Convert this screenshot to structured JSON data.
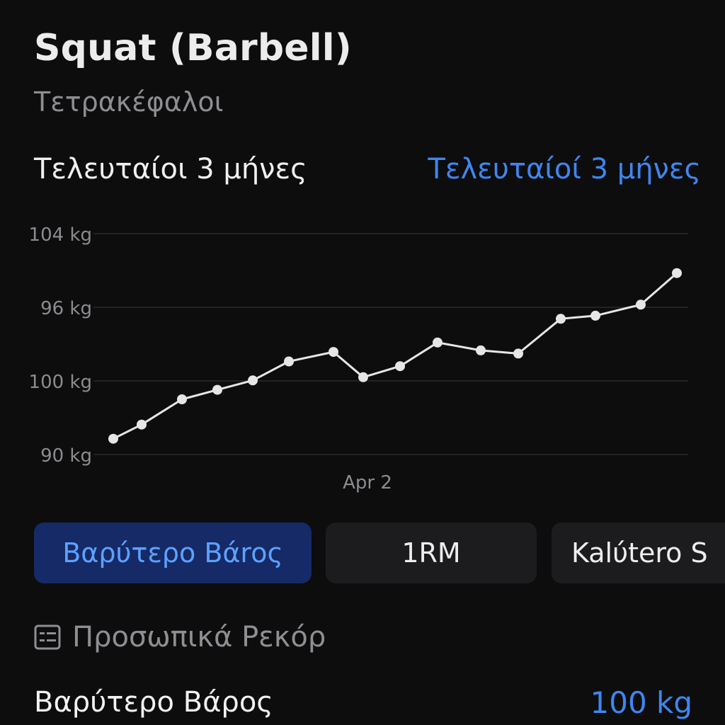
{
  "header": {
    "title": "Squat (Barbell)",
    "subtitle": "Τετρακέφαλοι"
  },
  "range": {
    "label": "Τελευταίοι 3 μήνες",
    "selector": "Τελευταίοί 3 μήνες"
  },
  "chart_data": {
    "type": "line",
    "y_tick_labels": [
      "104 kg",
      "96 kg",
      "100 kg",
      "90 kg"
    ],
    "x_tick_labels": [
      "Apr 2"
    ],
    "series": [
      {
        "values": [
          91.0,
          91.9,
          93.5,
          94.1,
          94.7,
          95.9,
          96.5,
          94.9,
          95.6,
          97.1,
          96.6,
          96.4,
          98.6,
          98.8,
          99.5,
          101.5
        ]
      }
    ],
    "line_color": "#e6e6e6",
    "grid": true
  },
  "metric_tabs": [
    {
      "label": "Βαρύτερο Βάroς",
      "active": true
    },
    {
      "label": "1RM",
      "active": false
    },
    {
      "label": "Kalύtero S",
      "active": false
    }
  ],
  "records": {
    "header": "Προσωπικά Ρεκόρ",
    "header_icon": "list-icon",
    "rows": [
      {
        "label": "Βαρύτερο Βάρος",
        "value": "100 kg"
      }
    ]
  },
  "colors": {
    "accent": "#3f86f0",
    "active_tab_bg": "#152a66",
    "background": "#0d0d0e"
  }
}
